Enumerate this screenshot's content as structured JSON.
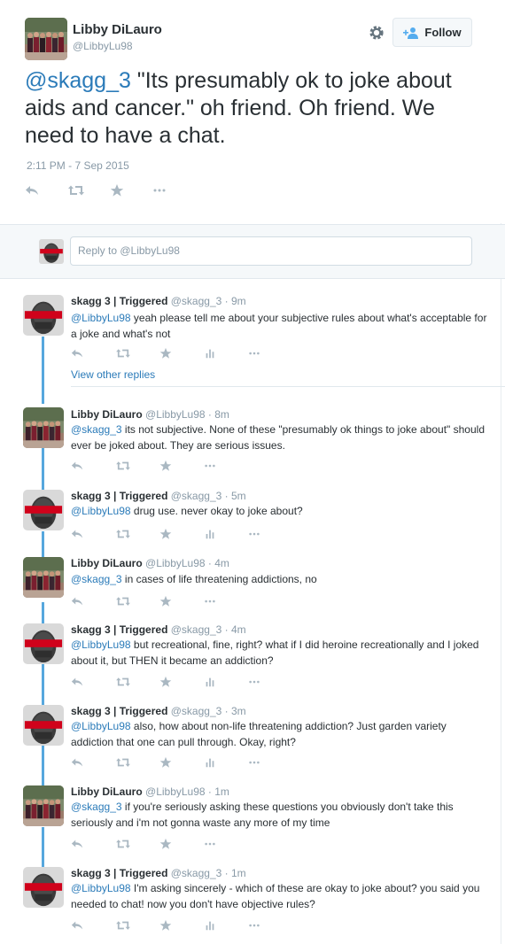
{
  "tweet": {
    "author_name": "Libby DiLauro",
    "author_handle": "@LibbyLu98",
    "follow_label": "Follow",
    "mention": "@skagg_3",
    "text": " \"Its presumably ok to joke about aids and cancer.\" oh friend. Oh friend. We need to have a chat.",
    "timestamp": "2:11 PM - 7 Sep 2015"
  },
  "reply_box": {
    "placeholder": "Reply to @LibbyLu98"
  },
  "avatar": {
    "skagg_badge": "#TRIGGERED"
  },
  "view_other_replies": "View other replies",
  "replies": [
    {
      "name": "skagg 3 | Triggered",
      "meta": " @skagg_3 · 9m",
      "mention": "@LibbyLu98",
      "text": " yeah please tell me about your subjective rules about what's acceptable for a joke and what's not"
    },
    {
      "name": "Libby DiLauro",
      "meta": " @LibbyLu98 · 8m",
      "mention": "@skagg_3",
      "text": " its not subjective. None of these \"presumably ok things to joke about\" should ever be joked about. They are serious issues."
    },
    {
      "name": "skagg 3 | Triggered",
      "meta": " @skagg_3 · 5m",
      "mention": "@LibbyLu98",
      "text": " drug use.  never okay to joke about?"
    },
    {
      "name": "Libby DiLauro",
      "meta": " @LibbyLu98 · 4m",
      "mention": "@skagg_3",
      "text": " in cases of life threatening addictions, no"
    },
    {
      "name": "skagg 3 | Triggered",
      "meta": " @skagg_3 · 4m",
      "mention": "@LibbyLu98",
      "text": " but recreational, fine, right?  what if I did heroine recreationally and I joked about it, but THEN it became an addiction?"
    },
    {
      "name": "skagg 3 | Triggered",
      "meta": " @skagg_3 · 3m",
      "mention": "@LibbyLu98",
      "text": " also, how about non-life threatening addiction?  Just garden variety addiction that one can pull through.  Okay, right?"
    },
    {
      "name": "Libby DiLauro",
      "meta": " @LibbyLu98 · 1m",
      "mention": "@skagg_3",
      "text": " if you're seriously asking these questions you obviously don't take this seriously and i'm not gonna waste any more of my time"
    },
    {
      "name": "skagg 3 | Triggered",
      "meta": " @skagg_3 · 1m",
      "mention": "@LibbyLu98",
      "text": " I'm asking sincerely - which of these are okay to joke about? you said you needed to chat! now you don't have objective rules?"
    }
  ],
  "colors": {
    "link": "#2b7bb9",
    "meta": "#8899a6",
    "thread_line": "#56a7dd",
    "text": "#292f33",
    "badge_red": "#d0021b"
  },
  "icons": [
    "gear-icon",
    "follow-person-icon",
    "reply-icon",
    "retweet-icon",
    "favorite-icon",
    "more-icon",
    "analytics-icon"
  ]
}
